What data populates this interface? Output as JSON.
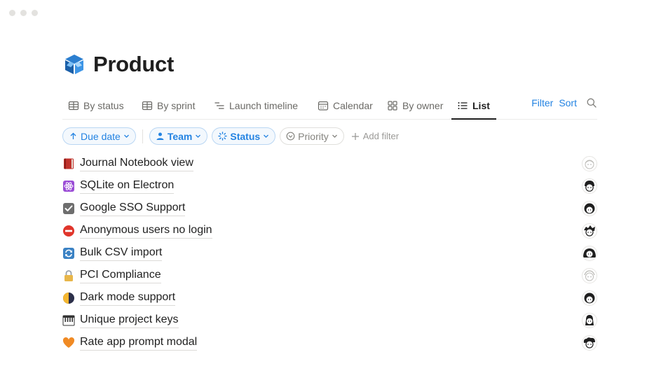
{
  "page": {
    "title": "Product",
    "icon": "cube-icon"
  },
  "tabs": [
    {
      "label": "By status",
      "icon": "table-icon"
    },
    {
      "label": "By sprint",
      "icon": "table-icon"
    },
    {
      "label": "Launch timeline",
      "icon": "timeline-icon"
    },
    {
      "label": "Calendar",
      "icon": "calendar-icon"
    },
    {
      "label": "By owner",
      "icon": "board-icon"
    },
    {
      "label": "List",
      "icon": "list-icon",
      "active": true
    }
  ],
  "toolbar": {
    "filter_label": "Filter",
    "sort_label": "Sort",
    "search_icon": "search-icon"
  },
  "filters": [
    {
      "label": "Due date",
      "icon": "arrow-up-icon",
      "style": "blue"
    },
    {
      "label": "Team",
      "icon": "person-icon",
      "style": "blue"
    },
    {
      "label": "Status",
      "icon": "status-icon",
      "style": "blue"
    },
    {
      "label": "Priority",
      "icon": "priority-icon",
      "style": "gray"
    }
  ],
  "add_filter_label": "Add filter",
  "items": [
    {
      "title": "Journal Notebook view",
      "icon": "red-book-icon",
      "avatar_tone": "light"
    },
    {
      "title": "SQLite on Electron",
      "icon": "atom-icon",
      "avatar_tone": "dark"
    },
    {
      "title": "Google SSO Support",
      "icon": "checkbox-icon",
      "avatar_tone": "dark"
    },
    {
      "title": "Anonymous users no login",
      "icon": "no-entry-icon",
      "avatar_tone": "dark"
    },
    {
      "title": "Bulk CSV import",
      "icon": "refresh-icon",
      "avatar_tone": "dark"
    },
    {
      "title": "PCI Compliance",
      "icon": "lock-icon",
      "avatar_tone": "light"
    },
    {
      "title": "Dark mode support",
      "icon": "half-moon-icon",
      "avatar_tone": "dark"
    },
    {
      "title": "Unique project keys",
      "icon": "piano-keys-icon",
      "avatar_tone": "dark"
    },
    {
      "title": "Rate app prompt modal",
      "icon": "orange-heart-icon",
      "avatar_tone": "dark"
    }
  ],
  "colors": {
    "accent": "#2383e2",
    "text": "#1f1f1f",
    "muted": "#6b6a66"
  }
}
